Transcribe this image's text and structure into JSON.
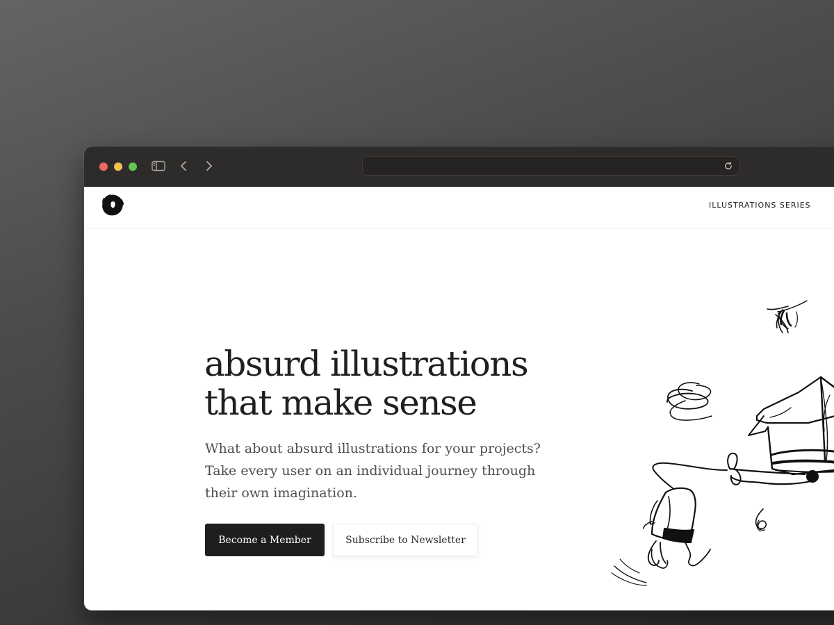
{
  "browser": {
    "url": "",
    "controls": {
      "close": "close-window",
      "minimize": "minimize-window",
      "zoom": "zoom-window",
      "sidebar_icon": "sidebar-icon",
      "back_icon": "chevron-left-icon",
      "forward_icon": "chevron-right-icon",
      "reload_icon": "reload-icon"
    },
    "colors": {
      "close": "#ed6a5e",
      "minimize": "#f4bf4f",
      "zoom": "#61c554",
      "toolbar": "#2e2c2b"
    }
  },
  "site": {
    "logo_icon": "blob-logo-icon",
    "nav": {
      "link": "ILLUSTRATIONS SERIES"
    }
  },
  "hero": {
    "title_line1": "absurd illustrations",
    "title_line2": "that make sense",
    "description": "What about absurd illustrations for your projects? Take every user on an individual journey through their own imagination.",
    "primary_button": "Become a Member",
    "secondary_button": "Subscribe to Newsletter",
    "illustration_icon": "absurd-sketch-illustration"
  },
  "colors": {
    "primary_button_bg": "#1e1e1e",
    "text": "#1f1f1f",
    "muted_text": "#4e4e4e"
  }
}
